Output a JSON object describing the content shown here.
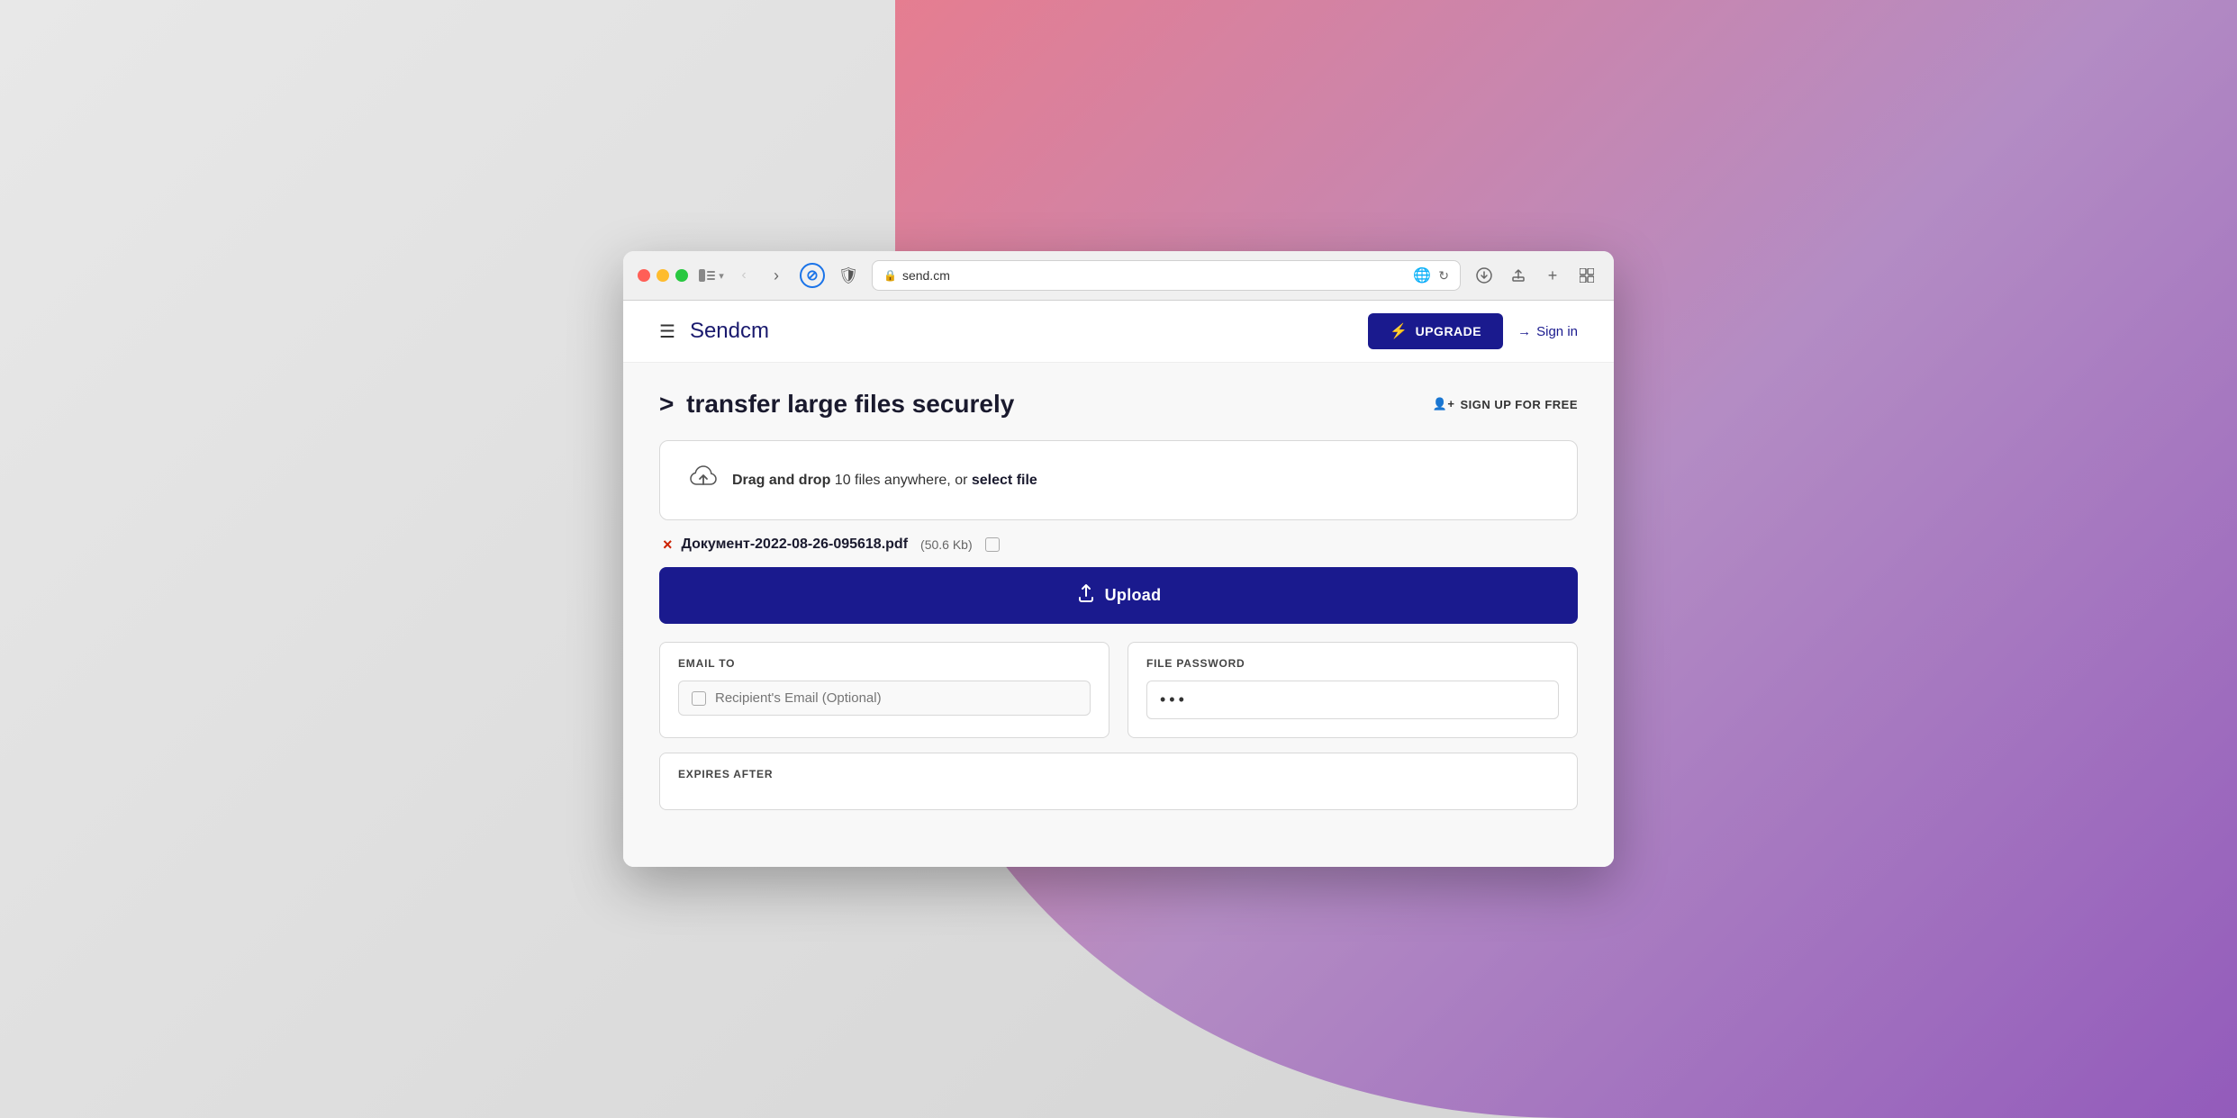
{
  "browser": {
    "url": "send.cm",
    "traffic_lights": [
      "red",
      "yellow",
      "green"
    ]
  },
  "navbar": {
    "hamburger_label": "☰",
    "brand_name_bold": "Send",
    "brand_name_light": "cm",
    "upgrade_label": "UPGRADE",
    "upgrade_icon": "↑",
    "signin_label": "Sign in",
    "signin_icon": "→"
  },
  "page": {
    "title_arrow": ">",
    "title_text": "transfer large files securely",
    "signup_label": "SIGN UP FOR FREE",
    "signup_icon": "👤"
  },
  "dropzone": {
    "icon": "⬆",
    "text_bold": "Drag and drop",
    "text_regular": " 10 files anywhere, or ",
    "text_link": "select file"
  },
  "file_item": {
    "remove_label": "×",
    "filename": "Документ-2022-08-26-095618.pdf",
    "filesize": "(50.6 Kb)"
  },
  "upload_button": {
    "icon": "⬆",
    "label": "Upload"
  },
  "email_section": {
    "label": "EMAIL TO",
    "placeholder": "Recipient's Email (Optional)"
  },
  "password_section": {
    "label": "FILE PASSWORD",
    "value": "···"
  },
  "expires_section": {
    "label": "EXPIRES AFTER"
  }
}
